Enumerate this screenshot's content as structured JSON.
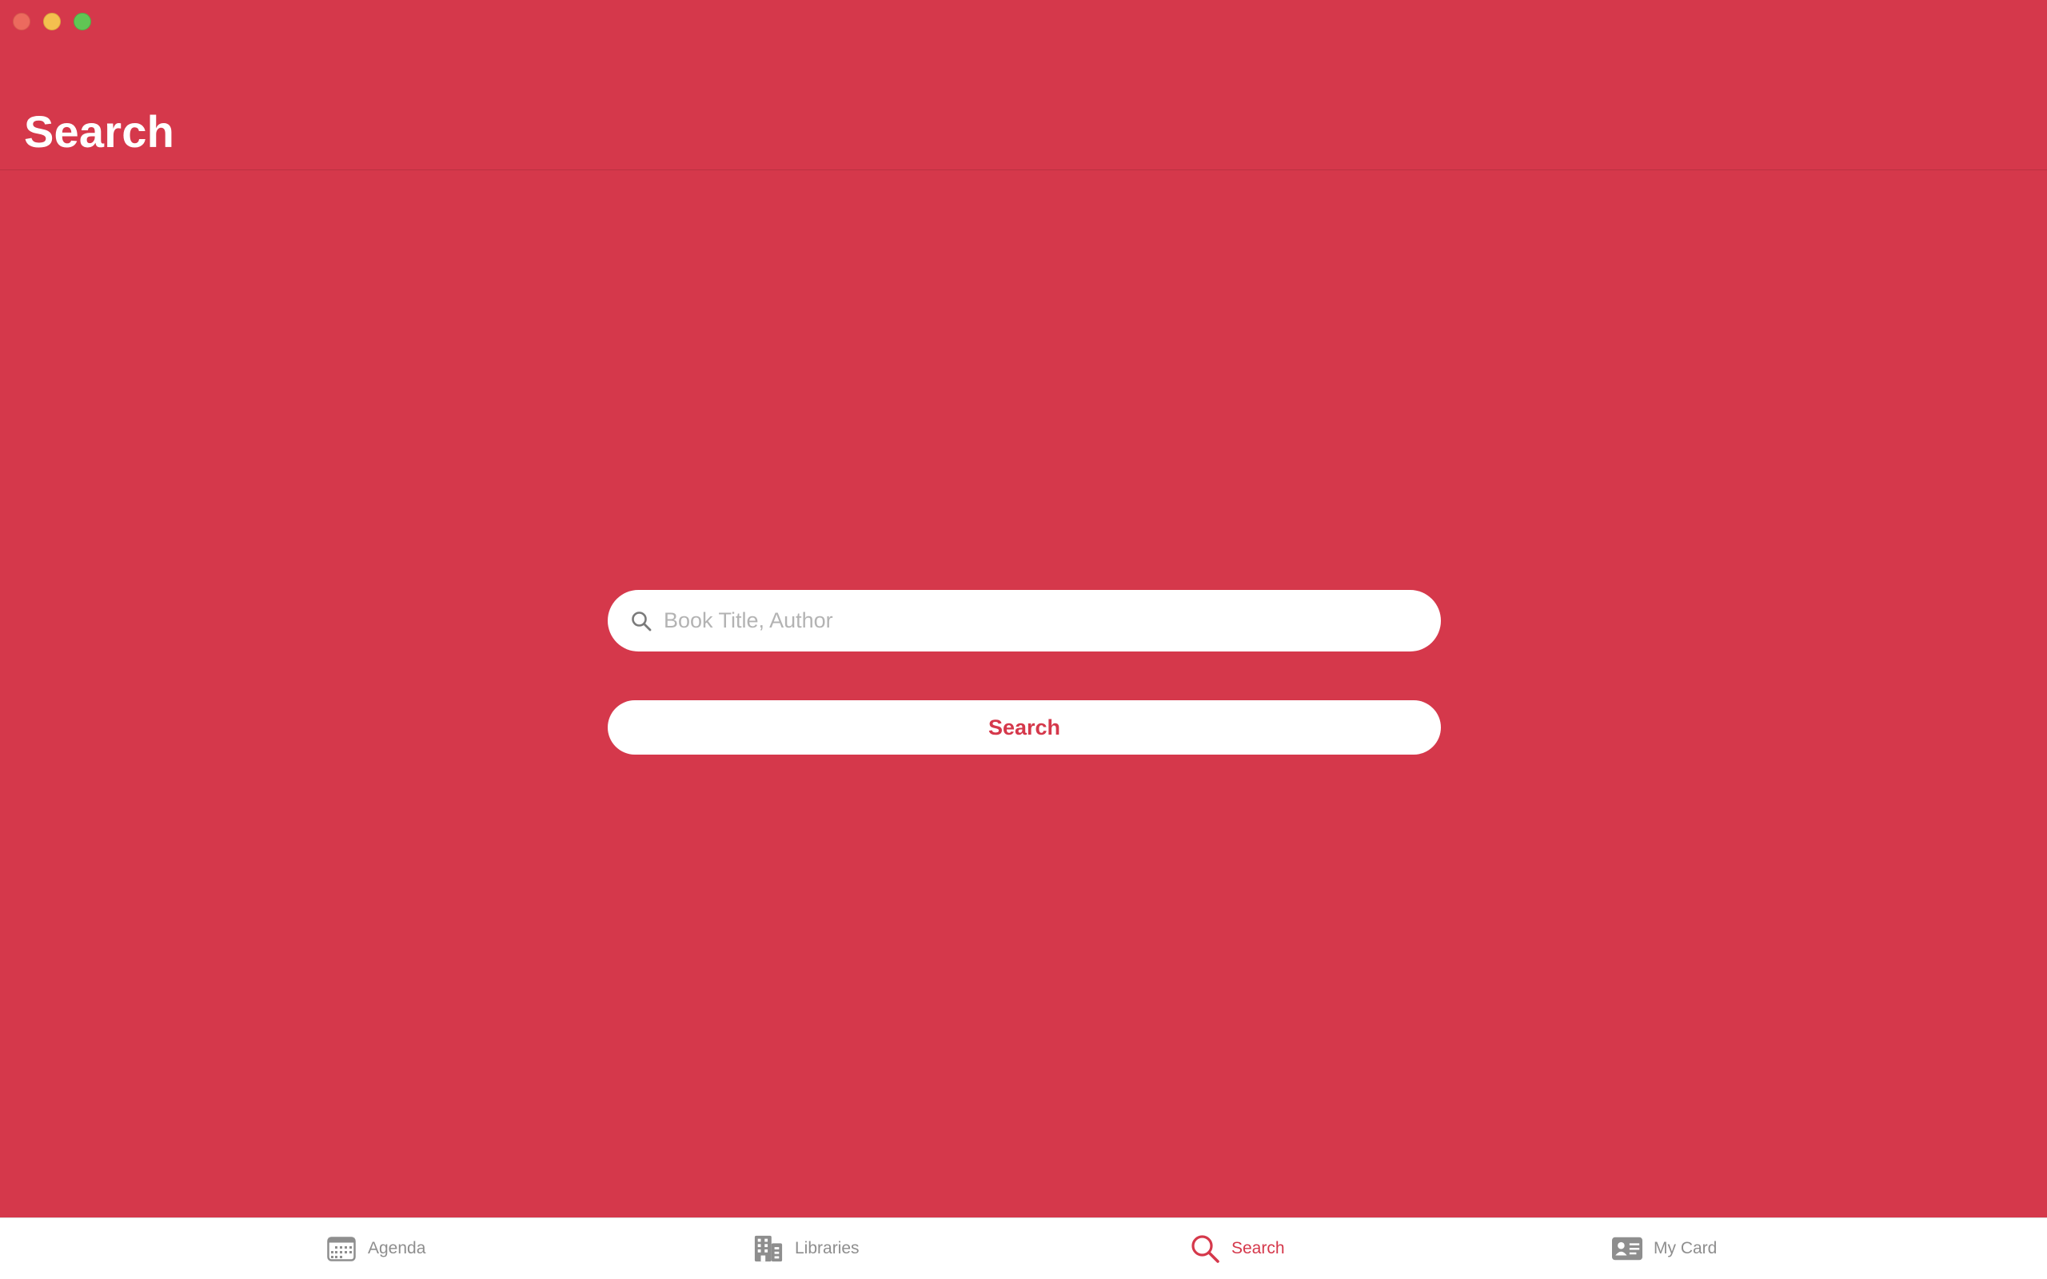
{
  "app": {
    "accent_color": "#d5384b",
    "background_color": "#d5384b"
  },
  "window": {
    "traffic_lights": [
      "close",
      "minimize",
      "zoom"
    ]
  },
  "header": {
    "title": "Search"
  },
  "search": {
    "placeholder": "Book Title, Author",
    "value": "",
    "icon": "magnifying-glass-icon",
    "button_label": "Search"
  },
  "tab_bar": {
    "active": "search",
    "tabs": [
      {
        "id": "agenda",
        "label": "Agenda",
        "icon": "calendar-icon"
      },
      {
        "id": "libraries",
        "label": "Libraries",
        "icon": "building-icon"
      },
      {
        "id": "search",
        "label": "Search",
        "icon": "magnifying-glass-icon"
      },
      {
        "id": "mycard",
        "label": "My Card",
        "icon": "id-card-icon"
      }
    ]
  }
}
